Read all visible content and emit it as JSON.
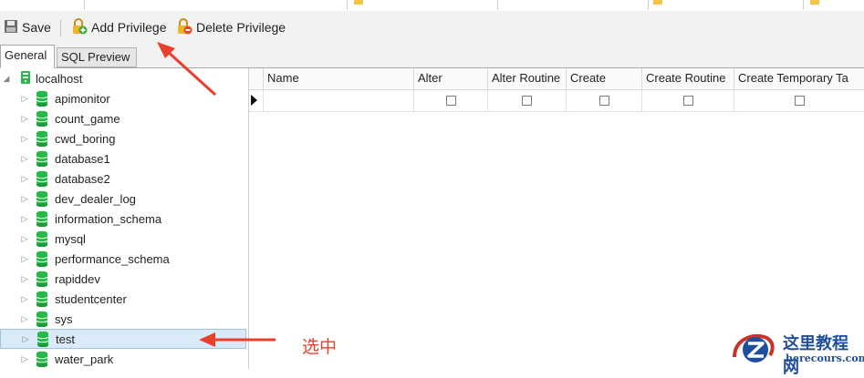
{
  "toolbar": {
    "save_label": "Save",
    "add_privilege_label": "Add Privilege",
    "delete_privilege_label": "Delete Privilege"
  },
  "tabs": [
    {
      "label": "General",
      "active": true
    },
    {
      "label": "SQL Preview",
      "active": false
    }
  ],
  "tree": {
    "root": "localhost",
    "databases": [
      "apimonitor",
      "count_game",
      "cwd_boring",
      "database1",
      "database2",
      "dev_dealer_log",
      "information_schema",
      "mysql",
      "performance_schema",
      "rapiddev",
      "studentcenter",
      "sys",
      "test",
      "water_park"
    ],
    "selected": "test"
  },
  "grid": {
    "columns": [
      "Name",
      "Alter",
      "Alter Routine",
      "Create",
      "Create Routine",
      "Create Temporary Ta"
    ],
    "row": {
      "name": "",
      "checked": [
        false,
        false,
        false,
        false,
        false
      ]
    }
  },
  "annotation": {
    "label": "选中"
  },
  "watermark": {
    "title": "这里教程网",
    "domain": "herecours.com"
  },
  "colors": {
    "annotation": "#e8402a",
    "db_icon": "#27b84a",
    "selected_row": "#dbeaf9"
  }
}
